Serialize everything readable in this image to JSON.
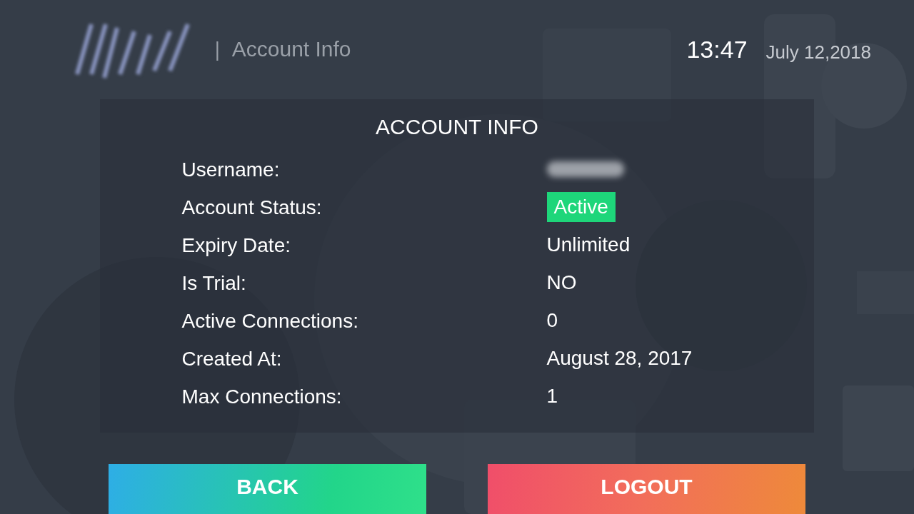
{
  "header": {
    "separator": "|",
    "section_title": "Account Info",
    "time": "13:47",
    "date": "July 12,2018"
  },
  "panel": {
    "title": "ACCOUNT INFO",
    "rows": [
      {
        "label": "Username:",
        "kind": "redacted"
      },
      {
        "label": "Account Status:",
        "kind": "badge",
        "value": "Active",
        "color": "#1ed67a"
      },
      {
        "label": "Expiry Date:",
        "kind": "text",
        "value": "Unlimited"
      },
      {
        "label": "Is Trial:",
        "kind": "text",
        "value": "NO"
      },
      {
        "label": "Active Connections:",
        "kind": "text",
        "value": "0"
      },
      {
        "label": "Created At:",
        "kind": "text",
        "value": "August 28, 2017"
      },
      {
        "label": "Max Connections:",
        "kind": "text",
        "value": "1"
      }
    ]
  },
  "buttons": [
    {
      "label": "BACK",
      "kind": "back"
    },
    {
      "label": "LOGOUT",
      "kind": "logout"
    }
  ]
}
